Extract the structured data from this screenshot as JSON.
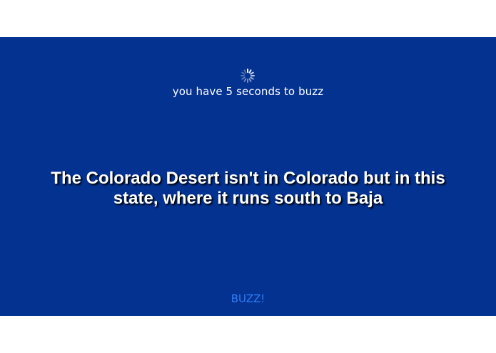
{
  "timer": {
    "message": "you have 5 seconds to buzz",
    "spinner_icon": "loading-spinner-icon"
  },
  "clue": {
    "text": "The Colorado Desert isn't in Colorado but in this state, where it runs south to Baja"
  },
  "buzz_button": {
    "label": "BUZZ!"
  },
  "colors": {
    "board_background": "#033291",
    "page_background": "#ffffff",
    "text": "#ffffff",
    "buzz_link": "#2f7df6"
  }
}
